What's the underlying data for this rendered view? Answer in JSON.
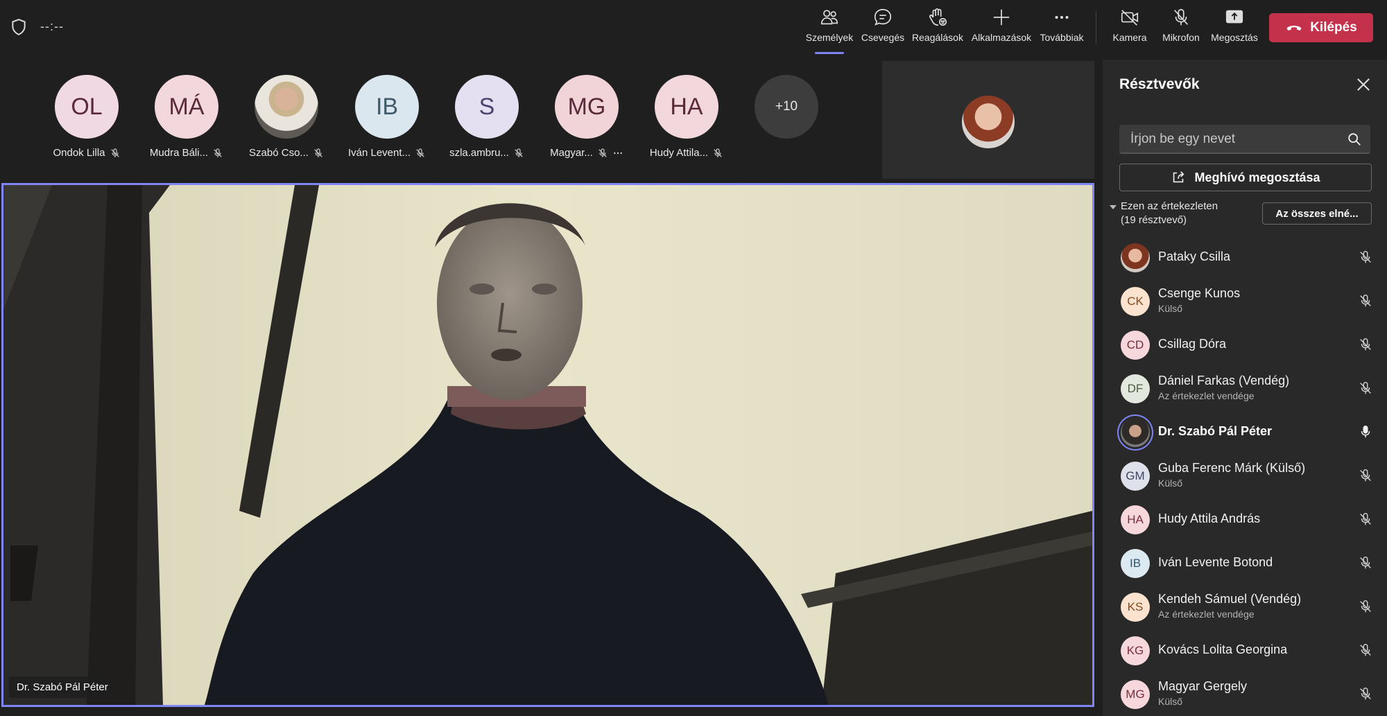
{
  "topbar": {
    "timer": "--:--",
    "buttons": [
      {
        "label": "Személyek",
        "icon": "people-icon"
      },
      {
        "label": "Csevegés",
        "icon": "chat-icon"
      },
      {
        "label": "Reagálások",
        "icon": "raise-hand-icon"
      },
      {
        "label": "Alkalmazások",
        "icon": "plus-icon"
      },
      {
        "label": "Továbbiak",
        "icon": "more-icon"
      },
      {
        "label": "Kamera",
        "icon": "camera-off-icon"
      },
      {
        "label": "Mikrofon",
        "icon": "mic-off-icon"
      },
      {
        "label": "Megosztás",
        "icon": "share-icon"
      }
    ],
    "leave_label": "Kilépés",
    "accent": "#7f85f5",
    "leave_color": "#c4314b"
  },
  "strip": {
    "participants": [
      {
        "initials": "OL",
        "name": "Ondok Lilla",
        "bg": "#f1d9e4"
      },
      {
        "initials": "MÁ",
        "name": "Mudra Báli...",
        "bg": "#f2d7dc"
      },
      {
        "initials": "",
        "name": "Szabó Cso...",
        "bg": "#777"
      },
      {
        "initials": "IB",
        "name": "Iván Levent...",
        "bg": "#dbe7ee"
      },
      {
        "initials": "S",
        "name": "szla.ambru...",
        "bg": "#e4e0f1"
      },
      {
        "initials": "MG",
        "name": "Magyar...",
        "bg": "#f1d4d8"
      },
      {
        "initials": "HA",
        "name": "Hudy Attila...",
        "bg": "#f2d7dc"
      }
    ],
    "more_count": "+10"
  },
  "main_video": {
    "name": "Dr. Szabó Pál Péter"
  },
  "panel": {
    "title": "Résztvevők",
    "search_placeholder": "Írjon be egy nevet",
    "invite_label": "Meghívó megosztása",
    "section_label": "Ezen az értekezleten (19 résztvevő)",
    "mute_all_label": "Az összes elné...",
    "people": [
      {
        "initials": "",
        "name": "Pataky Csilla",
        "sub": "",
        "bg": "photo1",
        "mic": "off"
      },
      {
        "initials": "CK",
        "name": "Csenge Kunos",
        "sub": "Külső",
        "bg": "#fbe3cf",
        "fg": "#8a4a1e",
        "mic": "off"
      },
      {
        "initials": "CD",
        "name": "Csillag Dóra",
        "sub": "",
        "bg": "#f6d8dc",
        "fg": "#7b2c3a",
        "mic": "off"
      },
      {
        "initials": "DF",
        "name": "Dániel Farkas (Vendég)",
        "sub": "Az értekezlet vendége",
        "bg": "#e3e8df",
        "fg": "#4d5a44",
        "mic": "off"
      },
      {
        "initials": "",
        "name": "Dr. Szabó Pál Péter",
        "sub": "",
        "bg": "photo2",
        "mic": "on",
        "bold": true
      },
      {
        "initials": "GM",
        "name": "Guba Ferenc Márk (Külső)",
        "sub": "Külső",
        "bg": "#dfe1ea",
        "fg": "#3d4560",
        "mic": "off"
      },
      {
        "initials": "HA",
        "name": "Hudy Attila András",
        "sub": "",
        "bg": "#f6d8dc",
        "fg": "#7b2c3a",
        "mic": "off"
      },
      {
        "initials": "IB",
        "name": "Iván Levente Botond",
        "sub": "",
        "bg": "#dce9f1",
        "fg": "#2f5670",
        "mic": "off"
      },
      {
        "initials": "KS",
        "name": "Kendeh Sámuel (Vendég)",
        "sub": "Az értekezlet vendége",
        "bg": "#fbe3cf",
        "fg": "#8a4a1e",
        "mic": "off"
      },
      {
        "initials": "KG",
        "name": "Kovács Lolita Georgina",
        "sub": "",
        "bg": "#f6d8dc",
        "fg": "#7b2c3a",
        "mic": "off"
      },
      {
        "initials": "MG",
        "name": "Magyar Gergely",
        "sub": "Külső",
        "bg": "#f6d8dc",
        "fg": "#7b2c3a",
        "mic": "off"
      }
    ]
  }
}
